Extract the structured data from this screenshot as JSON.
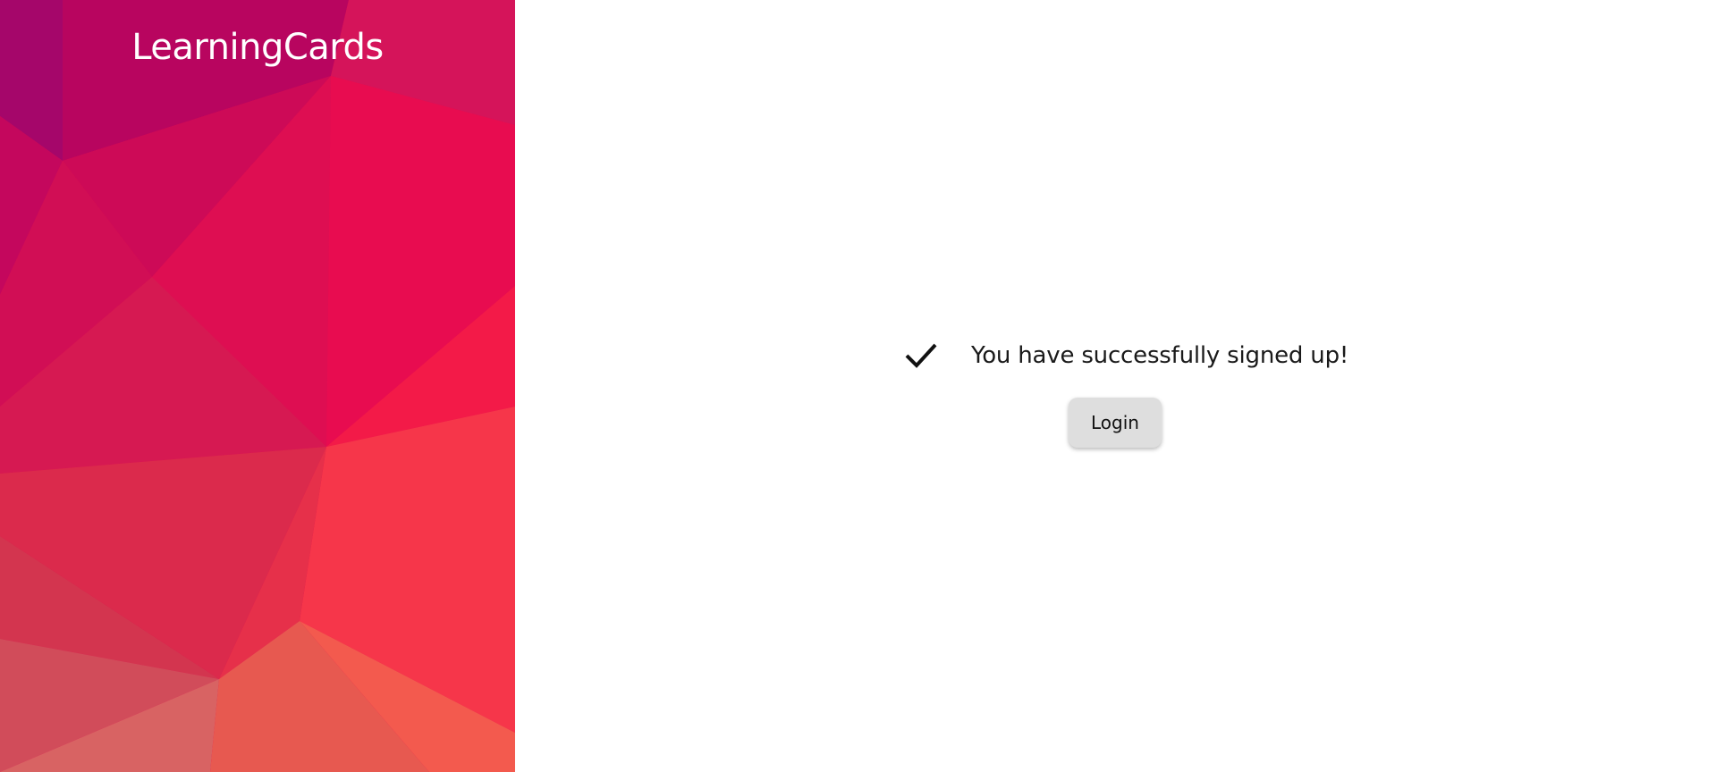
{
  "brand": {
    "title": "LearningCards"
  },
  "icons": {
    "status": "check-icon"
  },
  "main": {
    "message": "You have successfully signed up!",
    "login_label": "Login"
  },
  "colors": {
    "panel_base": "#e30c50",
    "button_bg": "#dedede",
    "text": "#1a1a1a",
    "brand_text": "#ffffff"
  }
}
